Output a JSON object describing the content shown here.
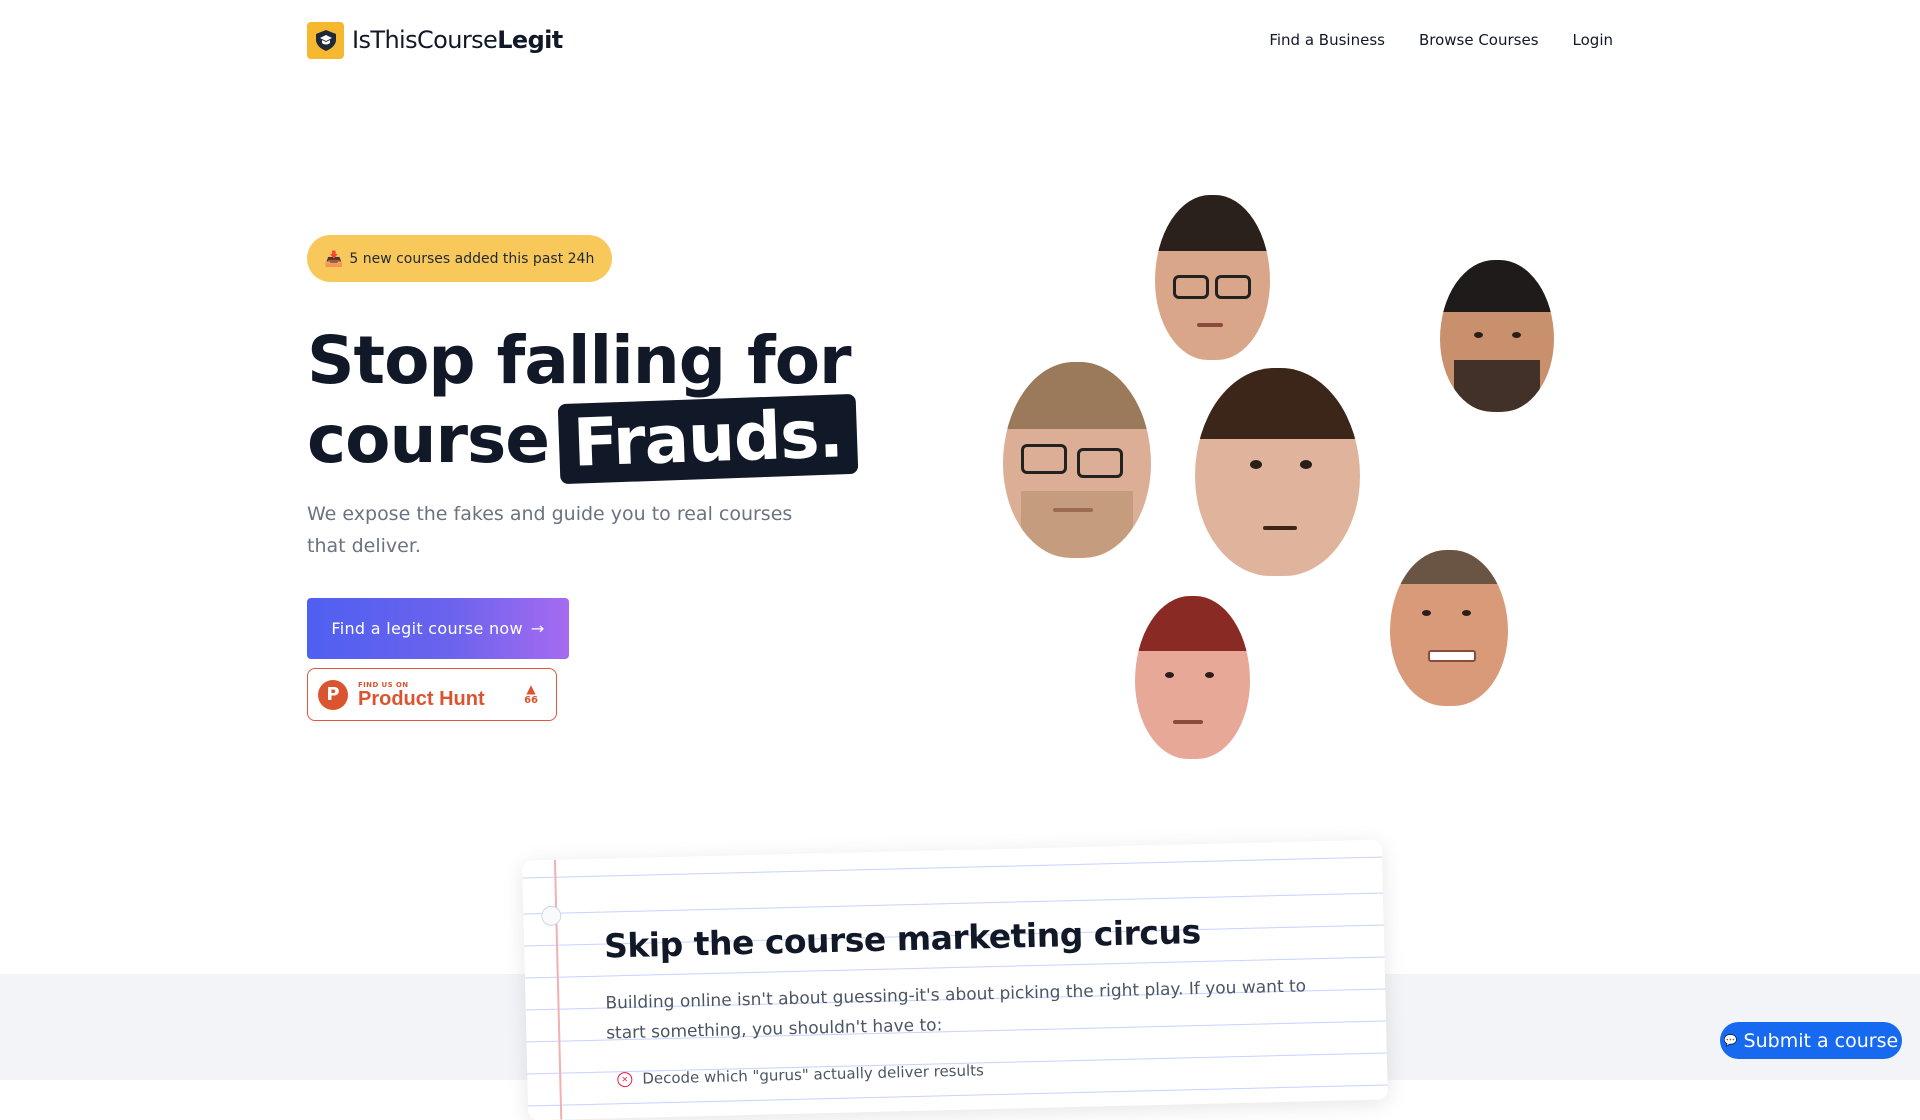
{
  "brand": {
    "name_light": "IsThisCourse",
    "name_bold": "Legit",
    "accent": "#f5b82e"
  },
  "nav": {
    "items": [
      "Find a Business",
      "Browse Courses",
      "Login"
    ]
  },
  "hero": {
    "badge_icon": "inbox-tray-icon",
    "badge_text": "5 new courses added this past 24h",
    "headline_line1": "Stop falling for",
    "headline_line2_prefix": "course",
    "headline_highlight": "Frauds.",
    "subtitle": "We expose the fakes and guide you to real courses that deliver.",
    "cta_label": "Find a legit course now",
    "cta_arrow": "→",
    "cta_colors": [
      "#4f5ff0",
      "#a66bf0"
    ]
  },
  "product_hunt": {
    "logo_letter": "P",
    "small_label": "FIND US ON",
    "big_label": "Product Hunt",
    "arrow": "▲",
    "votes": "66",
    "color": "#da552f"
  },
  "card": {
    "title": "Skip the course marketing circus",
    "text": "Building online isn't about guessing-it's about picking the right play. If you want to start something, you shouldn't have to:",
    "items": [
      "Decode which \"gurus\" actually deliver results"
    ]
  },
  "floating": {
    "submit_label": "Submit a course",
    "submit_icon": "chat-bubble-icon"
  }
}
